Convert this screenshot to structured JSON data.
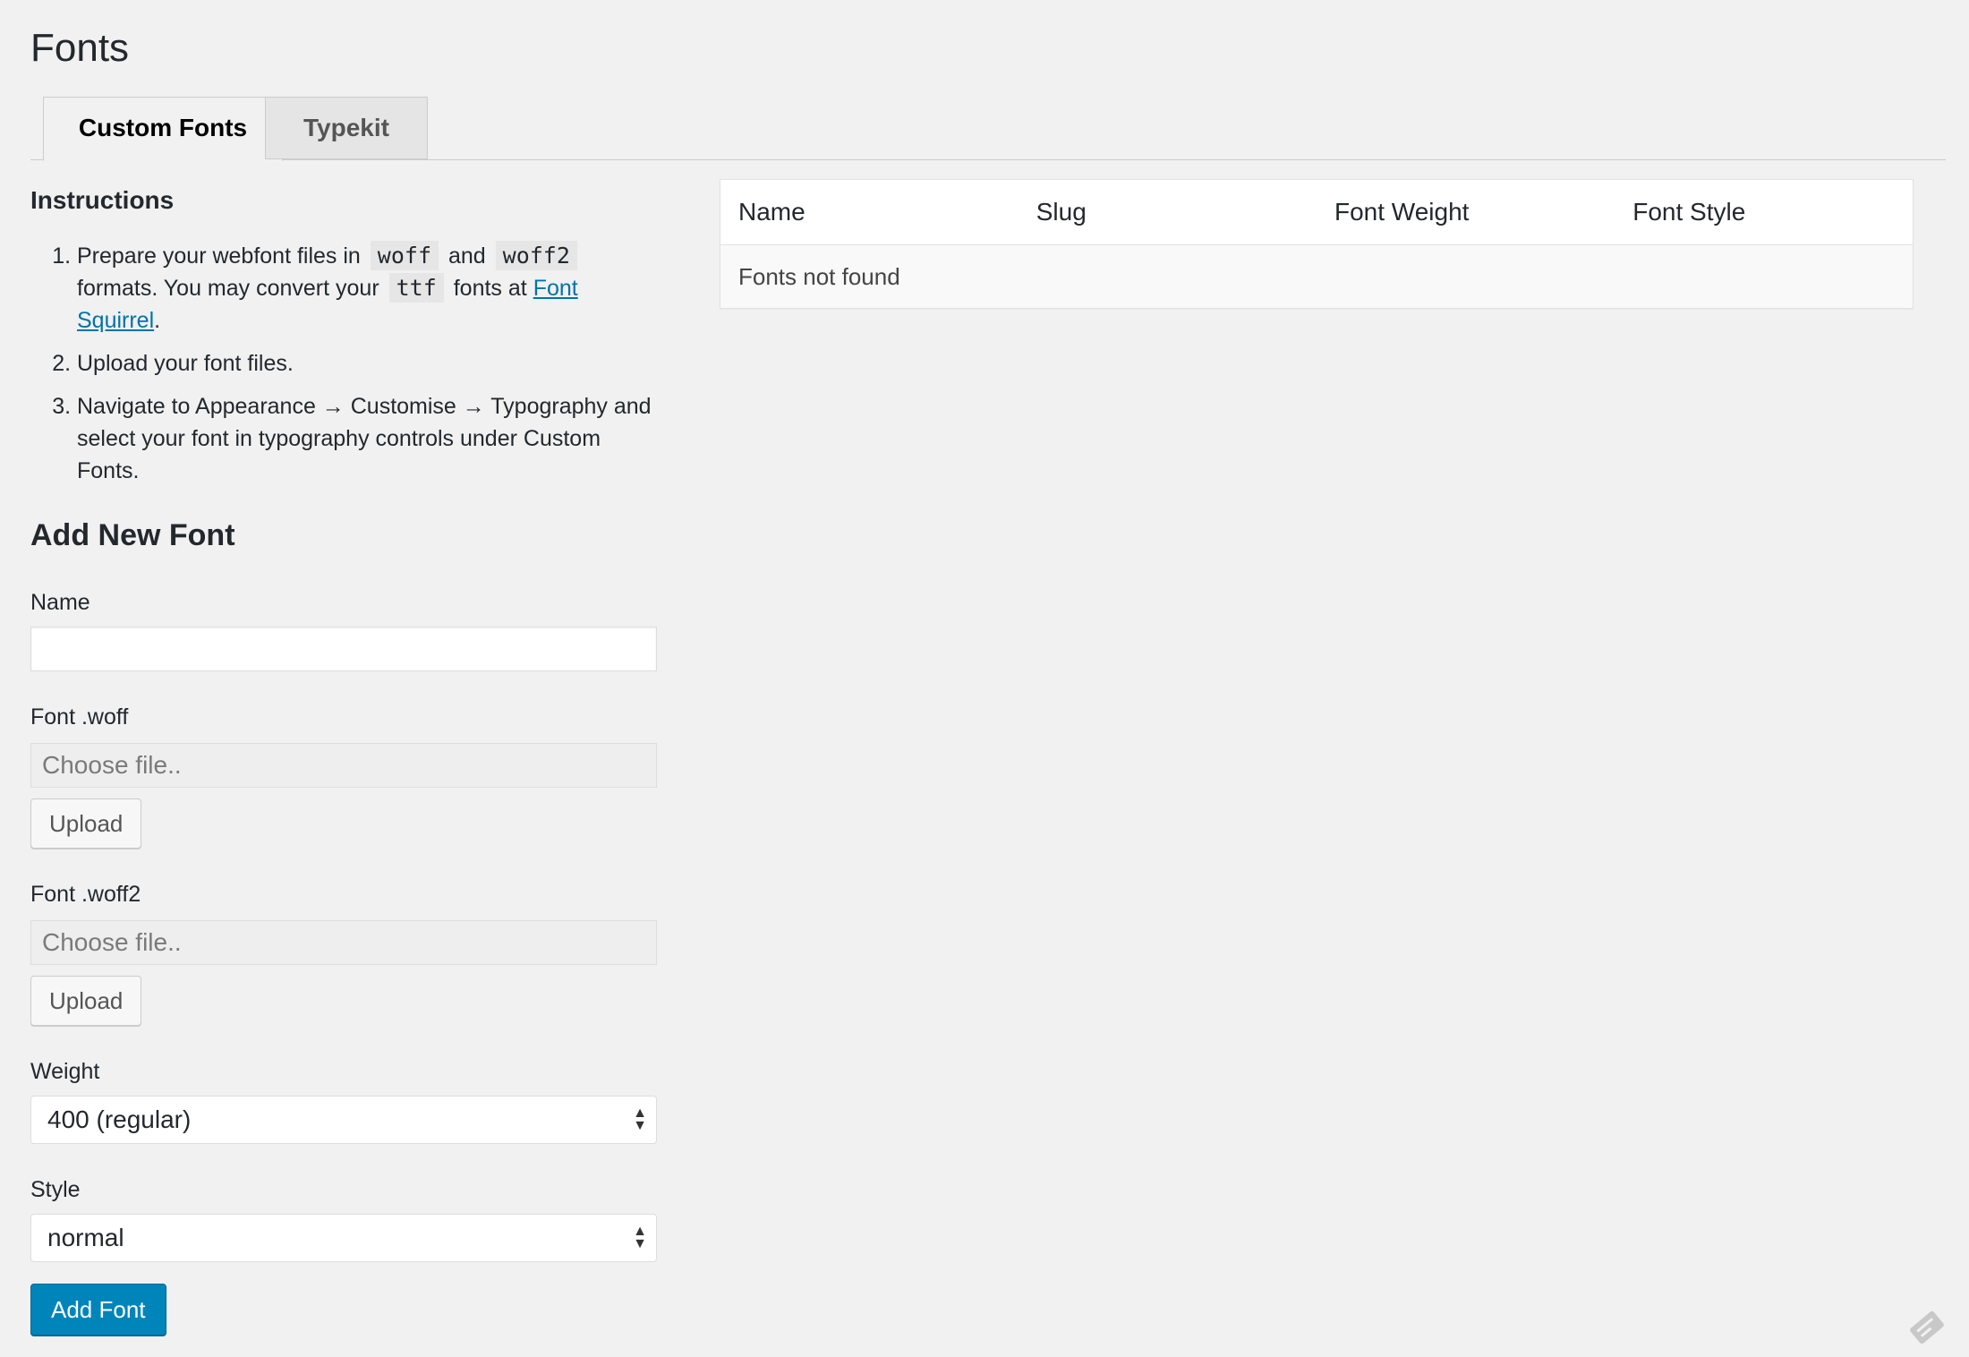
{
  "page": {
    "title": "Fonts"
  },
  "tabs": [
    {
      "label": "Custom Fonts",
      "active": true
    },
    {
      "label": "Typekit",
      "active": false
    }
  ],
  "instructions": {
    "title": "Instructions",
    "step1": {
      "t1": "Prepare your webfont files in",
      "code1": "woff",
      "t2": "and",
      "code2": "woff2",
      "t3": "formats. You may convert your",
      "code3": "ttf",
      "t4": "fonts at",
      "link": "Font Squirrel",
      "t5": "."
    },
    "step2": "Upload your font files.",
    "step3": "Navigate to Appearance → Customise → Typography and select your font in typography controls under Custom Fonts."
  },
  "form": {
    "title": "Add New Font",
    "name_label": "Name",
    "name_value": "",
    "woff_label": "Font .woff",
    "woff_placeholder": "Choose file..",
    "woff_upload": "Upload",
    "woff2_label": "Font .woff2",
    "woff2_placeholder": "Choose file..",
    "woff2_upload": "Upload",
    "weight_label": "Weight",
    "weight_value": "400 (regular)",
    "style_label": "Style",
    "style_value": "normal",
    "submit_label": "Add Font"
  },
  "table": {
    "headers": [
      "Name",
      "Slug",
      "Font Weight",
      "Font Style"
    ],
    "empty_message": "Fonts not found"
  },
  "colors": {
    "background": "#f1f1f1",
    "primary_button": "#0085ba",
    "link": "#0073aa"
  }
}
